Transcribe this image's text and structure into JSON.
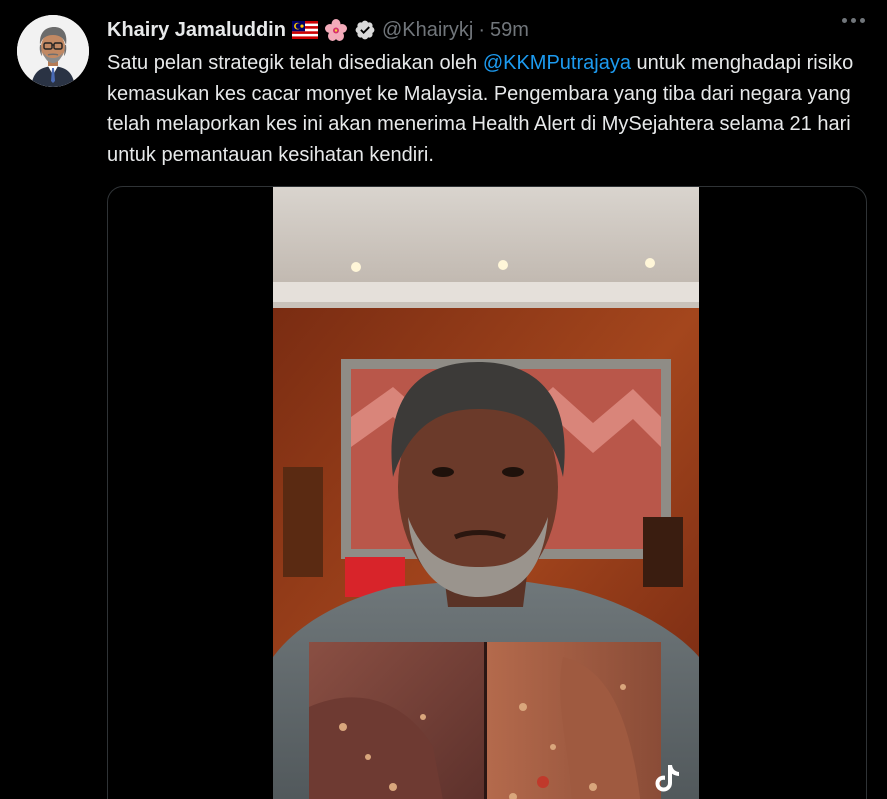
{
  "author": {
    "display_name": "Khairy Jamaluddin",
    "handle": "@Khairykj",
    "separator": "·",
    "time": "59m",
    "flag_emoji": "malaysia-flag",
    "flower_emoji": "hibiscus"
  },
  "tweet": {
    "text_part1": "Satu pelan strategik telah disediakan oleh ",
    "mention": "@KKMPutrajaya",
    "text_part2": " untuk menghadapi risiko kemasukan kes cacar monyet ke Malaysia. Pengembara yang tiba dari negara yang telah melaporkan kes ini akan menerima Health Alert di MySejahtera selama 21 hari untuk pemantauan kesihatan kendiri."
  },
  "media": {
    "type": "video",
    "watermark_icon": "tiktok-icon"
  },
  "icons": {
    "more": "more-horizontal-icon",
    "verified": "verified-badge-icon"
  },
  "colors": {
    "background": "#000000",
    "text": "#e7e9ea",
    "secondary": "#71767b",
    "link": "#1d9bf0",
    "border": "#2f3336"
  }
}
